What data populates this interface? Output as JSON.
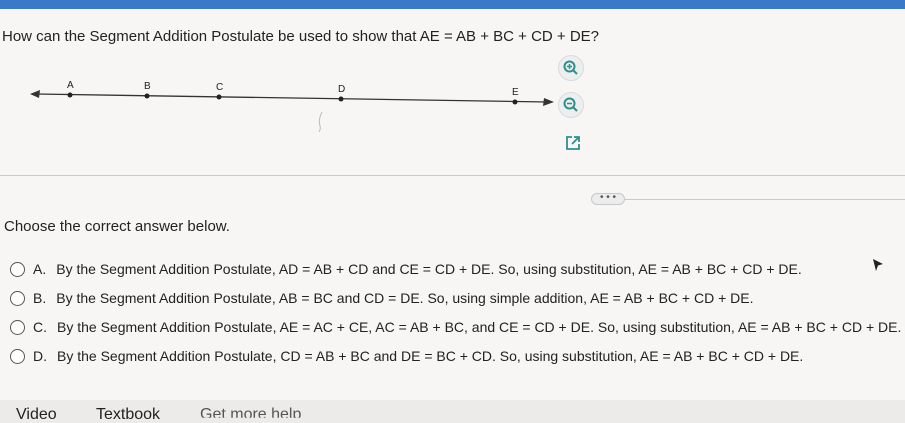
{
  "question": "How can the Segment Addition Postulate be used to show that AE = AB + BC + CD + DE?",
  "figure": {
    "point_labels": [
      "A",
      "B",
      "C",
      "D",
      "E"
    ]
  },
  "tools": {
    "zoom_in_icon": "zoom-in-icon",
    "zoom_out_icon": "zoom-out-icon",
    "popout_icon": "popout-icon"
  },
  "more_label": "• • •",
  "prompt": "Choose the correct answer below.",
  "options": [
    {
      "letter": "A.",
      "text": "By the Segment Addition Postulate, AD = AB + CD and CE = CD + DE. So, using substitution, AE = AB + BC + CD + DE."
    },
    {
      "letter": "B.",
      "text": "By the Segment Addition Postulate, AB = BC and CD = DE. So, using simple addition, AE = AB + BC + CD + DE."
    },
    {
      "letter": "C.",
      "text": "By the Segment Addition Postulate, AE = AC + CE, AC = AB + BC, and CE = CD + DE. So, using substitution, AE = AB + BC + CD + DE."
    },
    {
      "letter": "D.",
      "text": "By the Segment Addition Postulate, CD = AB + BC and DE = BC + CD. So, using substitution, AE = AB + BC + CD + DE."
    }
  ],
  "footer": {
    "video": "Video",
    "textbook": "Textbook",
    "help": "Get more help"
  },
  "colors": {
    "accent": "#3a78c9",
    "icon": "#2f8f8a"
  }
}
